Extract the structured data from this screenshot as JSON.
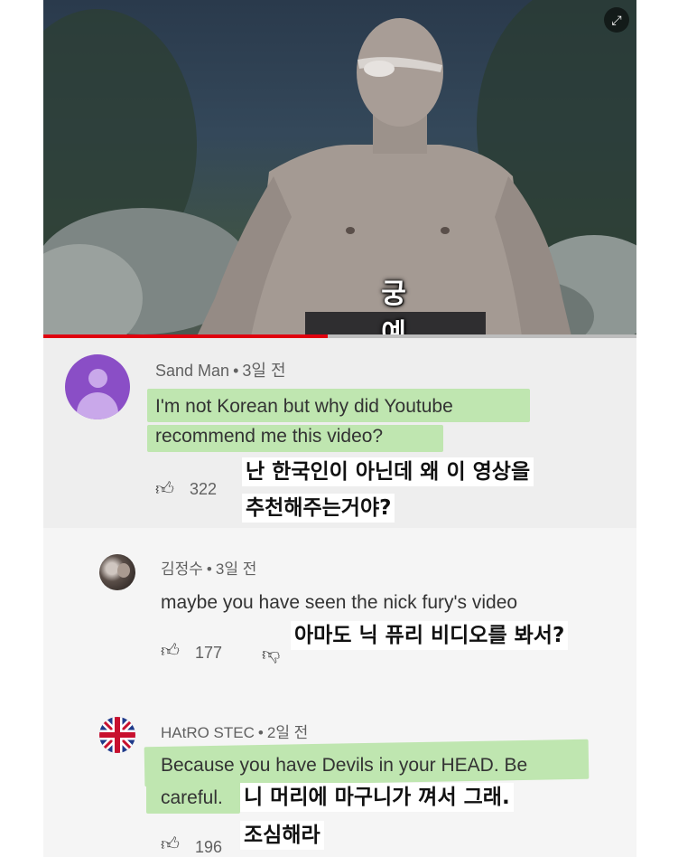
{
  "video": {
    "subtitle": "궁 예",
    "expand_icon": "expand-icon",
    "progress_fraction": 0.48,
    "progress_color": "#e0000f"
  },
  "comments": [
    {
      "author": "Sand Man",
      "time": "3일 전",
      "text_lines": [
        "I'm not Korean but why did Youtube",
        "recommend me this video?"
      ],
      "likes": "322",
      "translation_lines": [
        "난 한국인이 아닌데 왜 이 영상을",
        "추천해주는거야?"
      ],
      "avatar_color": "#8a4ec6"
    },
    {
      "author": "김정수",
      "time": "3일 전",
      "text_lines": [
        "maybe you have seen the nick fury's video"
      ],
      "likes": "177",
      "translation_lines": [
        "아마도 닉 퓨리 비디오를 봐서?"
      ]
    },
    {
      "author": "HAtRO STEC",
      "time": "2일 전",
      "text_lines": [
        "Because you have Devils in your HEAD. Be",
        "careful."
      ],
      "likes": "196",
      "translation_lines": [
        "니 머리에 마구니가 껴서 그래.",
        "조심해라"
      ]
    }
  ],
  "icons": {
    "like": "thumbs-up-icon",
    "dislike": "thumbs-down-icon",
    "default_avatar": "person-icon",
    "flag": "union-jack-icon"
  },
  "separator": "•",
  "colors": {
    "highlight": "#bfe6b0",
    "block1_bg": "#eeeeee",
    "block2_bg": "#f5f5f5"
  }
}
